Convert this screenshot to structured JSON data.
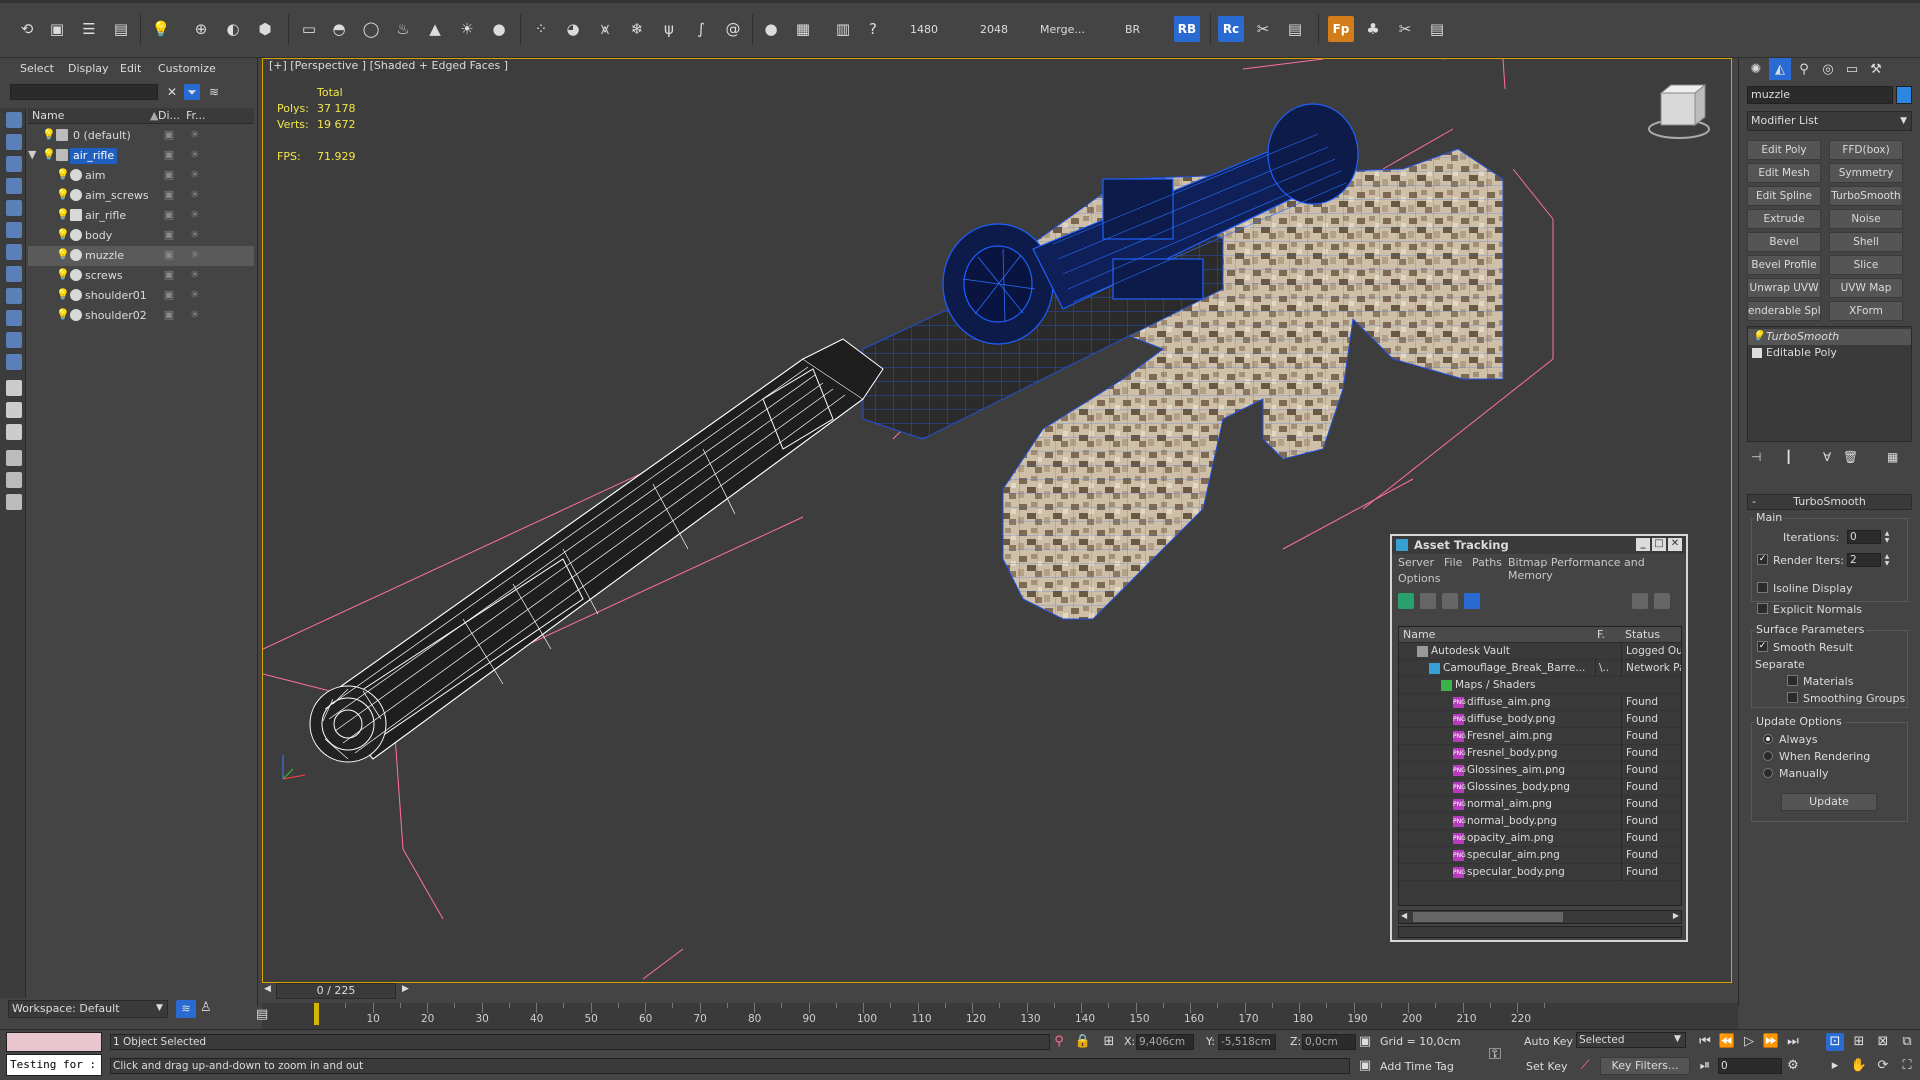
{
  "toolbar": {
    "render_width": "1480",
    "render_height": "2048",
    "merge_label": "Merge...",
    "br_label": "BR",
    "rb_label": "RB",
    "rc_label": "Rc",
    "fp_label": "Fp"
  },
  "explorer": {
    "menu": [
      "Select",
      "Display",
      "Edit",
      "Customize"
    ],
    "columns": {
      "name": "Name",
      "display": "Di...",
      "freeze": "Fr..."
    },
    "rows": [
      {
        "name": "0 (default)",
        "type": "layer"
      },
      {
        "name": "air_rifle",
        "type": "layer"
      },
      {
        "name": "aim",
        "type": "object"
      },
      {
        "name": "aim_screws",
        "type": "object"
      },
      {
        "name": "air_rifle",
        "type": "object"
      },
      {
        "name": "body",
        "type": "object"
      },
      {
        "name": "muzzle",
        "type": "object"
      },
      {
        "name": "screws",
        "type": "object"
      },
      {
        "name": "shoulder01",
        "type": "object"
      },
      {
        "name": "shoulder02",
        "type": "object"
      }
    ],
    "workspace": "Workspace: Default"
  },
  "viewport": {
    "label": "[+] [Perspective ] [Shaded + Edged Faces ]",
    "stats": {
      "total_label": "Total",
      "polys_label": "Polys:",
      "polys_value": "37 178",
      "verts_label": "Verts:",
      "verts_value": "19 672",
      "fps_label": "FPS:",
      "fps_value": "71.929"
    }
  },
  "command_panel": {
    "object_name": "muzzle",
    "modifier_list": "Modifier List",
    "modifier_buttons": [
      "Edit Poly",
      "FFD(box)",
      "Edit Mesh",
      "Symmetry",
      "Edit Spline",
      "TurboSmooth",
      "Extrude",
      "Noise",
      "Bevel",
      "Shell",
      "Bevel Profile",
      "Slice",
      "Unwrap UVW",
      "UVW Map",
      "enderable Splin",
      "XForm"
    ],
    "stack": [
      {
        "label": "TurboSmooth",
        "active": true
      },
      {
        "label": "Editable Poly",
        "active": false
      }
    ],
    "turbosmooth": {
      "title": "TurboSmooth",
      "main_label": "Main",
      "iterations_label": "Iterations:",
      "iterations_value": "0",
      "render_iters_label": "Render Iters:",
      "render_iters_value": "2",
      "isoline_label": "Isoline Display",
      "explicit_normals_label": "Explicit Normals",
      "surface_params_label": "Surface Parameters",
      "smooth_result_label": "Smooth Result",
      "separate_label": "Separate",
      "materials_label": "Materials",
      "smoothing_groups_label": "Smoothing Groups",
      "update_options_label": "Update Options",
      "always_label": "Always",
      "when_rendering_label": "When Rendering",
      "manually_label": "Manually",
      "update_button": "Update"
    }
  },
  "asset_tracking": {
    "title": "Asset Tracking",
    "menu": [
      "Server",
      "File",
      "Paths",
      "Bitmap Performance and Memory",
      "Options"
    ],
    "columns": {
      "name": "Name",
      "full_path": "F.",
      "status": "Status"
    },
    "rows": [
      {
        "name": "Autodesk Vault",
        "path": "",
        "status": "Logged Out (",
        "indent": 1,
        "icon": "vault"
      },
      {
        "name": "Camouflage_Break_Barre...",
        "path": "\\..",
        "status": "Network Path",
        "indent": 2,
        "icon": "max"
      },
      {
        "name": "Maps / Shaders",
        "path": "",
        "status": "",
        "indent": 3,
        "icon": "maps"
      },
      {
        "name": "diffuse_aim.png",
        "path": "",
        "status": "Found",
        "indent": 4,
        "icon": "png"
      },
      {
        "name": "diffuse_body.png",
        "path": "",
        "status": "Found",
        "indent": 4,
        "icon": "png"
      },
      {
        "name": "Fresnel_aim.png",
        "path": "",
        "status": "Found",
        "indent": 4,
        "icon": "png"
      },
      {
        "name": "Fresnel_body.png",
        "path": "",
        "status": "Found",
        "indent": 4,
        "icon": "png"
      },
      {
        "name": "Glossines_aim.png",
        "path": "",
        "status": "Found",
        "indent": 4,
        "icon": "png"
      },
      {
        "name": "Glossines_body.png",
        "path": "",
        "status": "Found",
        "indent": 4,
        "icon": "png"
      },
      {
        "name": "normal_aim.png",
        "path": "",
        "status": "Found",
        "indent": 4,
        "icon": "png"
      },
      {
        "name": "normal_body.png",
        "path": "",
        "status": "Found",
        "indent": 4,
        "icon": "png"
      },
      {
        "name": "opacity_aim.png",
        "path": "",
        "status": "Found",
        "indent": 4,
        "icon": "png"
      },
      {
        "name": "specular_aim.png",
        "path": "",
        "status": "Found",
        "indent": 4,
        "icon": "png"
      },
      {
        "name": "specular_body.png",
        "path": "",
        "status": "Found",
        "indent": 4,
        "icon": "png"
      }
    ]
  },
  "timeline": {
    "frame_display": "0 / 225",
    "ticks": [
      "10",
      "20",
      "30",
      "40",
      "50",
      "60",
      "70",
      "80",
      "90",
      "100",
      "110",
      "120",
      "130",
      "140",
      "150",
      "160",
      "170",
      "180",
      "190",
      "200",
      "210",
      "220"
    ]
  },
  "status_bar": {
    "listener_text": "Testing for :",
    "selection_text": "1 Object Selected",
    "prompt_text": "Click and drag up-and-down to zoom in and out",
    "x_label": "X:",
    "x_value": "9,406cm",
    "y_label": "Y:",
    "y_value": "-5,518cm",
    "z_label": "Z:",
    "z_value": "0,0cm",
    "grid_text": "Grid = 10,0cm",
    "add_time_tag": "Add Time Tag",
    "auto_key": "Auto Key",
    "set_key": "Set Key",
    "selected_dropdown": "Selected",
    "key_filters": "Key Filters...",
    "frame_value": "0"
  }
}
